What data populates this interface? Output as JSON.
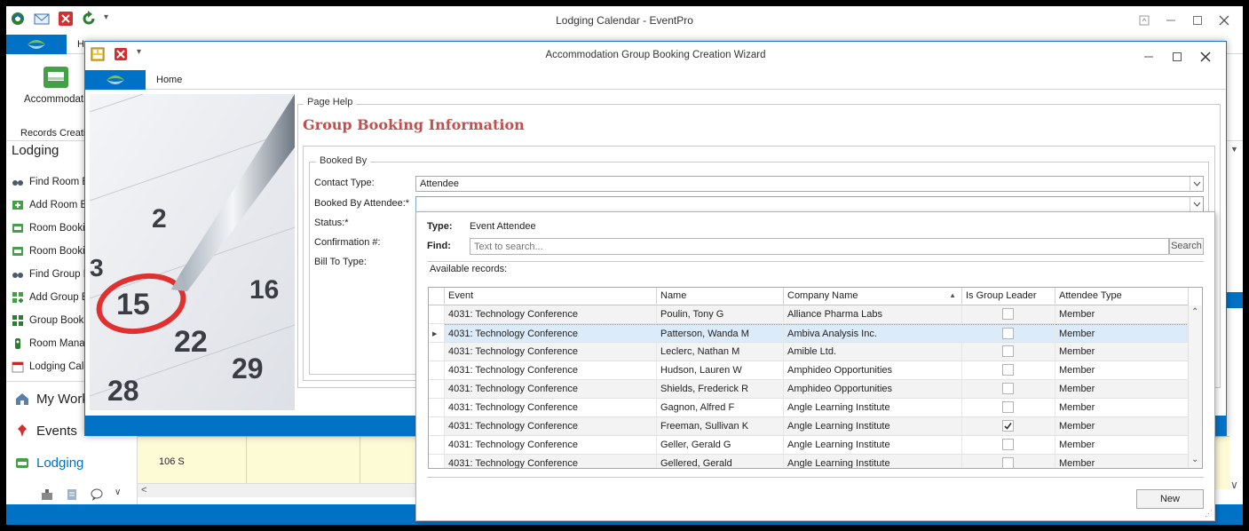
{
  "main_window": {
    "title": "Lodging Calendar - EventPro",
    "tab_home": "H",
    "ribbon_big_button": "Accommodatio",
    "ribbon_group_label": "Records Creati",
    "nav_header": "Lodging",
    "nav_items": [
      {
        "label": "Find Room B",
        "icon": "binoculars-icon"
      },
      {
        "label": "Add Room B",
        "icon": "add-icon"
      },
      {
        "label": "Room Bookin",
        "icon": "bed-icon"
      },
      {
        "label": "Room Bookin",
        "icon": "bed-icon"
      },
      {
        "label": "Find Group E",
        "icon": "binoculars-icon"
      },
      {
        "label": "Add Group B",
        "icon": "add-group-icon"
      },
      {
        "label": "Group Booki",
        "icon": "group-icon"
      },
      {
        "label": "Room Manag",
        "icon": "room-icon"
      },
      {
        "label": "Lodging Cale",
        "icon": "calendar-icon"
      }
    ],
    "nav_big_items": [
      {
        "label": "My Work",
        "icon": "house-icon"
      },
      {
        "label": "Events",
        "icon": "pin-icon"
      },
      {
        "label": "Lodging",
        "icon": "lodging-icon"
      }
    ],
    "calendar_cell": "106 S"
  },
  "wizard": {
    "title": "Accommodation Group Booking Creation Wizard",
    "tab_home": "Home",
    "page_help_legend": "Page Help",
    "heading": "Group Booking Information",
    "booked_by_legend": "Booked By",
    "fields": {
      "contact_type_label": "Contact Type:",
      "contact_type_value": "Attendee",
      "booked_by_attendee_label": "Booked By Attendee:*",
      "status_label": "Status:*",
      "confirmation_label": "Confirmation #:",
      "bill_to_type_label": "Bill To Type:"
    },
    "calendar_numbers": [
      "2",
      "15",
      "16",
      "22",
      "29",
      "28",
      "3"
    ]
  },
  "popup": {
    "type_label": "Type:",
    "type_value": "Event Attendee",
    "find_label": "Find:",
    "search_placeholder": "Text to search...",
    "search_button": "Search",
    "available_records": "Available records:",
    "columns": [
      "Event",
      "Name",
      "Company Name",
      "Is Group Leader",
      "Attendee Type"
    ],
    "sorted_column": "Company Name",
    "rows": [
      {
        "event": "4031: Technology Conference",
        "name": "Poulin, Tony G",
        "company": "Alliance Pharma Labs",
        "leader": false,
        "type": "Member"
      },
      {
        "event": "4031: Technology Conference",
        "name": "Patterson, Wanda M",
        "company": "Ambiva Analysis Inc.",
        "leader": false,
        "type": "Member",
        "selected": true
      },
      {
        "event": "4031: Technology Conference",
        "name": "Leclerc, Nathan M",
        "company": "Amible Ltd.",
        "leader": false,
        "type": "Member"
      },
      {
        "event": "4031: Technology Conference",
        "name": "Hudson, Lauren W",
        "company": "Amphideo Opportunities",
        "leader": false,
        "type": "Member"
      },
      {
        "event": "4031: Technology Conference",
        "name": "Shields, Frederick R",
        "company": "Amphideo Opportunities",
        "leader": false,
        "type": "Member"
      },
      {
        "event": "4031: Technology Conference",
        "name": "Gagnon, Alfred F",
        "company": "Angle Learning Institute",
        "leader": false,
        "type": "Member"
      },
      {
        "event": "4031: Technology Conference",
        "name": "Freeman, Sullivan K",
        "company": "Angle Learning Institute",
        "leader": true,
        "type": "Member"
      },
      {
        "event": "4031: Technology Conference",
        "name": "Geller, Gerald G",
        "company": "Angle Learning Institute",
        "leader": false,
        "type": "Member"
      },
      {
        "event": "4031: Technology Conference",
        "name": "Gellered, Gerald",
        "company": "Angle Learning Institute",
        "leader": false,
        "type": "Member"
      }
    ],
    "new_button": "New"
  },
  "colors": {
    "accent_blue": "#0072c6",
    "heading_red": "#c0504d",
    "selected_row": "#dcebfa",
    "alt_row": "#f3f3f3"
  }
}
